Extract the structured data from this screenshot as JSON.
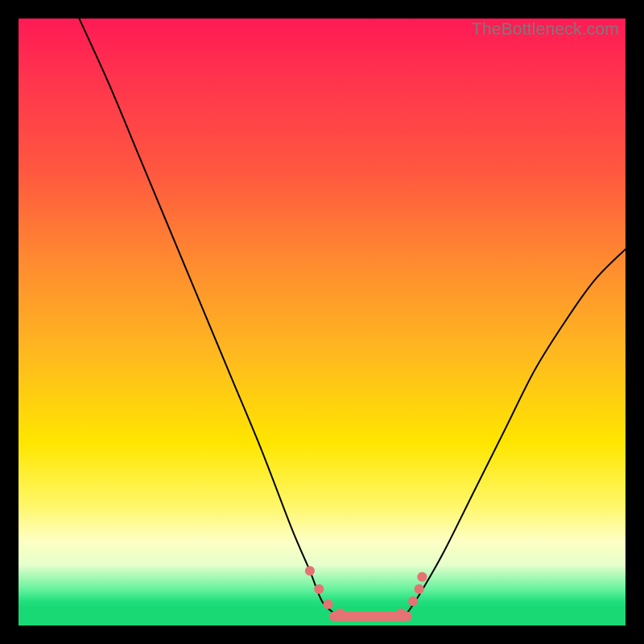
{
  "watermark": "TheBottleneck.com",
  "colors": {
    "frame": "#000000",
    "watermark_text": "#7a7a7a",
    "curve": "#000000",
    "marker": "#e57373",
    "gradient_top": "#ff1a55",
    "gradient_bottom": "#18d974"
  },
  "chart_data": {
    "type": "line",
    "title": "",
    "xlabel": "",
    "ylabel": "",
    "xlim": [
      0,
      100
    ],
    "ylim": [
      0,
      100
    ],
    "series": [
      {
        "name": "left-curve",
        "x": [
          10,
          15,
          20,
          25,
          30,
          35,
          40,
          45,
          48,
          50,
          52
        ],
        "y": [
          100,
          89,
          77,
          65,
          53,
          41,
          29,
          16,
          9,
          4,
          2
        ]
      },
      {
        "name": "right-curve",
        "x": [
          64,
          66,
          70,
          75,
          80,
          85,
          90,
          95,
          100
        ],
        "y": [
          2,
          5,
          12,
          22,
          32,
          42,
          50,
          57,
          62
        ]
      },
      {
        "name": "floor-segment",
        "x": [
          52,
          64
        ],
        "y": [
          1.5,
          1.5
        ]
      }
    ],
    "markers": {
      "name": "highlight-points",
      "points": [
        {
          "x": 48,
          "y": 9
        },
        {
          "x": 49.5,
          "y": 6
        },
        {
          "x": 51,
          "y": 3.5
        },
        {
          "x": 53,
          "y": 2
        },
        {
          "x": 56,
          "y": 1.5
        },
        {
          "x": 60,
          "y": 1.5
        },
        {
          "x": 63,
          "y": 2
        },
        {
          "x": 65,
          "y": 4
        },
        {
          "x": 66,
          "y": 6
        },
        {
          "x": 66.5,
          "y": 8
        }
      ],
      "radius": 6
    }
  }
}
